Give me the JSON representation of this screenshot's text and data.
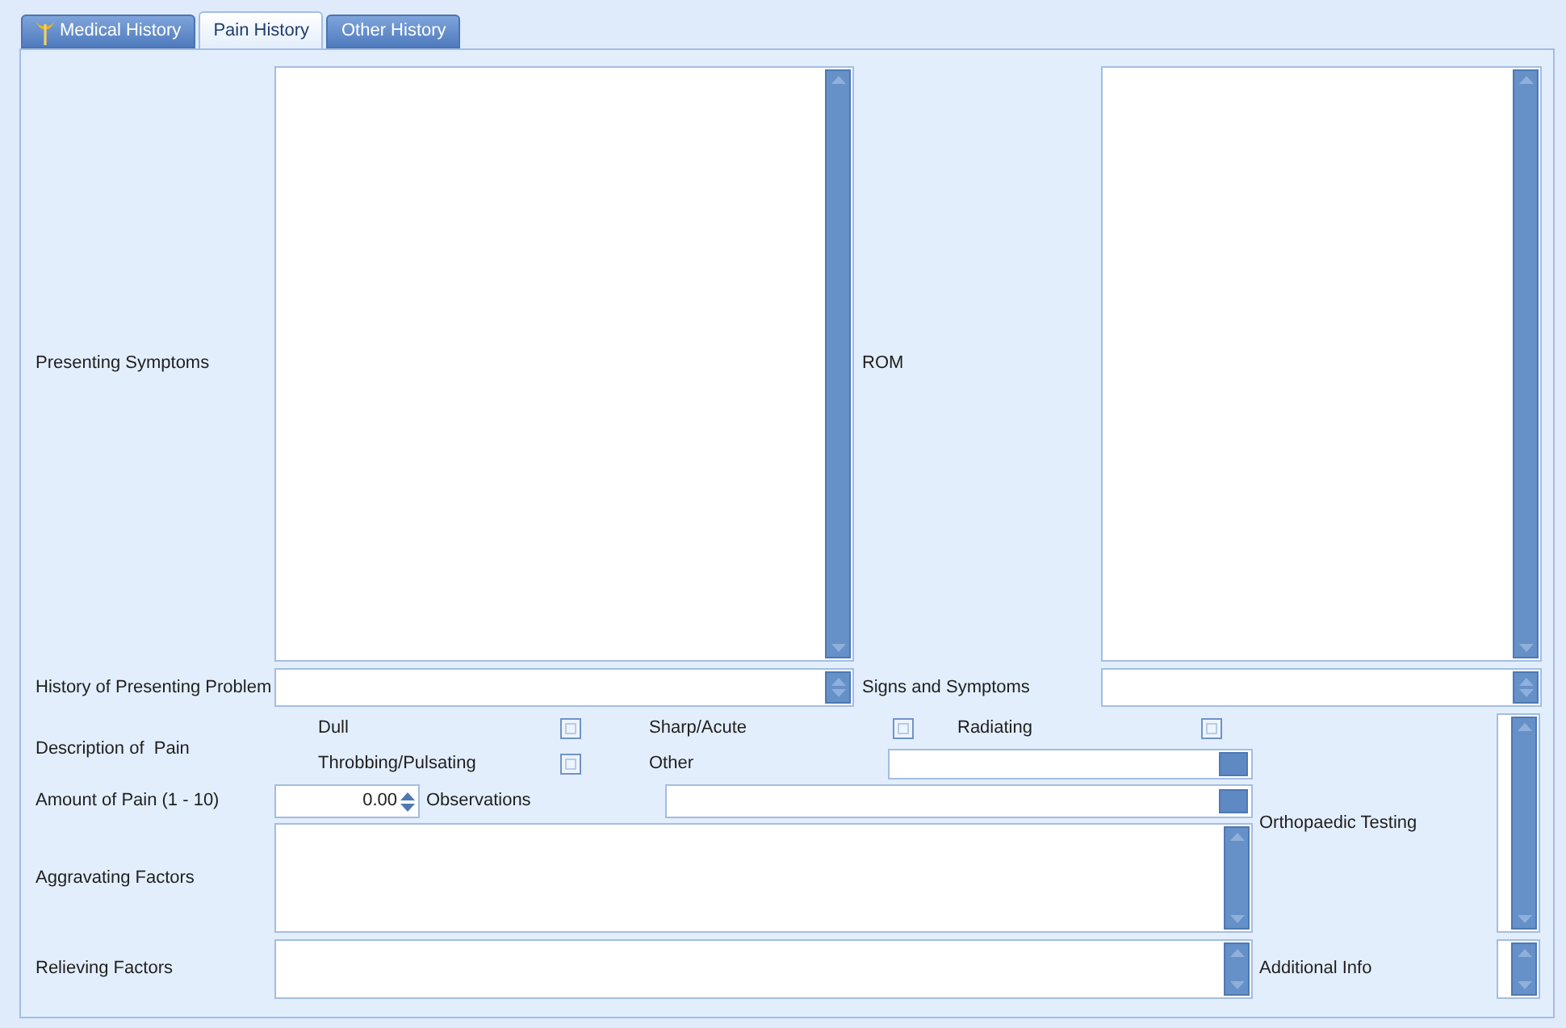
{
  "tabs": [
    {
      "label": "Medical History",
      "selected": false,
      "has_icon": true
    },
    {
      "label": "Pain History",
      "selected": true,
      "has_icon": false
    },
    {
      "label": "Other History",
      "selected": false,
      "has_icon": false
    }
  ],
  "presenting_symptoms": {
    "label": "Presenting Symptoms"
  },
  "rom": {
    "label": "ROM"
  },
  "history_of_presenting_problem": {
    "label": "History of Presenting Problem"
  },
  "signs_and_symptoms": {
    "label": "Signs and Symptoms"
  },
  "description_of_pain": {
    "label": "Description of  Pain",
    "options": [
      {
        "label": "Dull",
        "checked": false
      },
      {
        "label": "Sharp/Acute",
        "checked": false
      },
      {
        "label": "Radiating",
        "checked": false
      },
      {
        "label": "Throbbing/Pulsating",
        "checked": false
      }
    ]
  },
  "other": {
    "label": "Other"
  },
  "amount_of_pain": {
    "label": "Amount of Pain (1 - 10)",
    "value": "0.00"
  },
  "observations": {
    "label": "Observations"
  },
  "aggravating_factors": {
    "label": "Aggravating Factors"
  },
  "relieving_factors": {
    "label": "Relieving Factors"
  },
  "orthopaedic_testing": {
    "label": "Orthopaedic Testing"
  },
  "additional_info": {
    "label": "Additional Info"
  }
}
